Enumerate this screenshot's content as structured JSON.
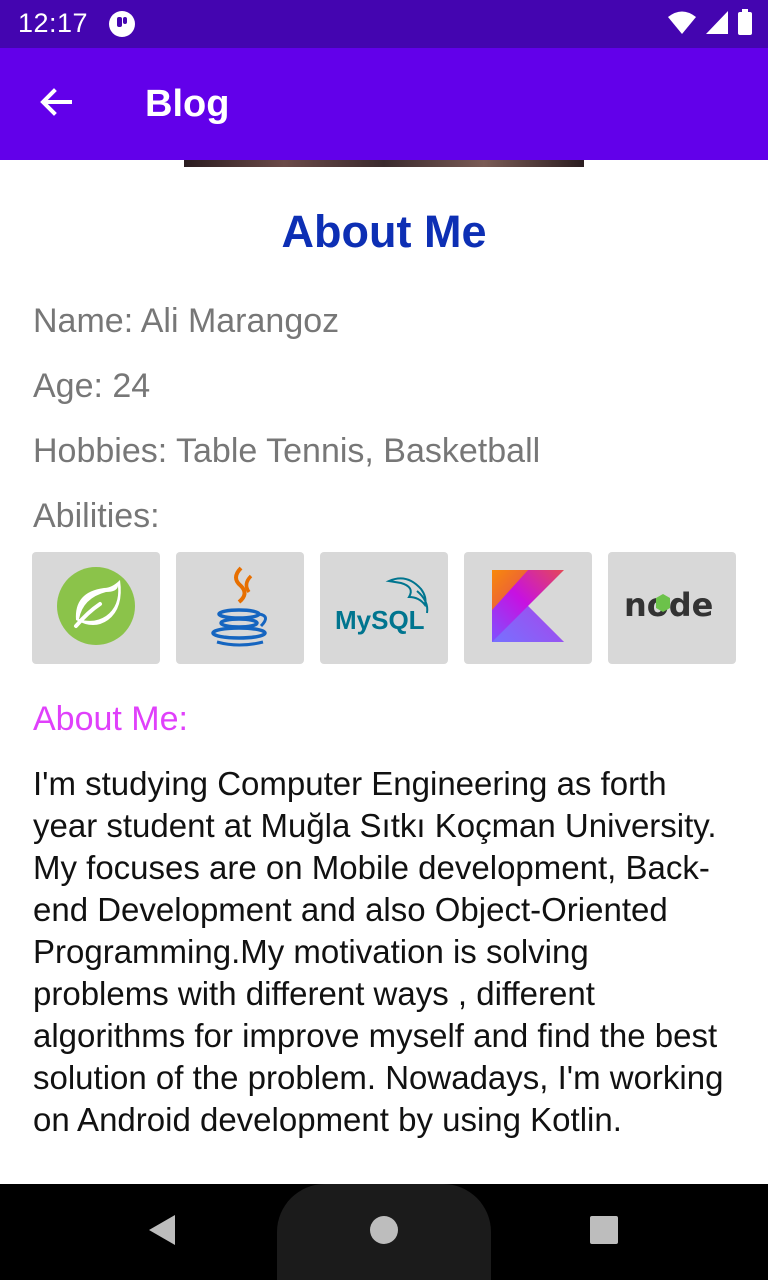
{
  "status_bar": {
    "time": "12:17",
    "icons": [
      "app-notification-icon",
      "wifi-icon",
      "signal-icon",
      "battery-icon"
    ]
  },
  "app_bar": {
    "title": "Blog",
    "back_icon": "back-arrow-icon"
  },
  "main": {
    "section_title": "About Me",
    "name_line": "Name: Ali Marangoz",
    "age_line": "Age: 24",
    "hobbies_line": "Hobbies: Table Tennis, Basketball",
    "abilities_label": "Abilities:",
    "abilities": [
      {
        "icon": "spring-icon"
      },
      {
        "icon": "java-icon"
      },
      {
        "icon": "mysql-icon",
        "logo_text": "MySQL"
      },
      {
        "icon": "kotlin-icon"
      },
      {
        "icon": "nodejs-icon",
        "logo_text": "node"
      }
    ],
    "about_label": "About Me:",
    "about_text": "I'm studying Computer Engineering as forth year student at Muğla Sıtkı Koçman University. My focuses are on Mobile development, Back-end Development and also Object-Oriented Programming.My motivation is solving problems with different ways , different algorithms for improve myself and find the best solution of the problem. Nowadays, I'm working on Android development by using Kotlin."
  },
  "nav_bar": {
    "icons": [
      "back-triangle-icon",
      "home-circle-icon",
      "recents-square-icon"
    ]
  },
  "colors": {
    "status_bar": "#4405b0",
    "app_bar": "#6200ea",
    "section_title": "#0d2fb4",
    "about_label": "#e040fb",
    "info_text": "#777777"
  }
}
